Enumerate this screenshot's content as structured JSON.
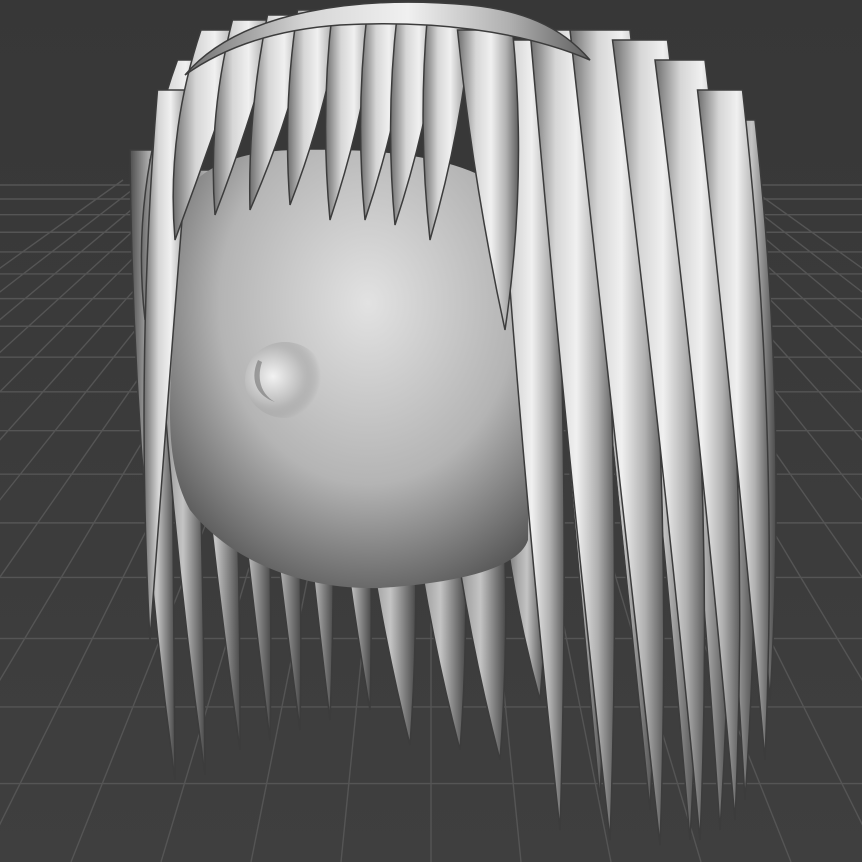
{
  "viewport": {
    "background_color": "#3a3a3a",
    "grid_line_color": "#555555",
    "model_base_color": "#c9c9c9",
    "model_shadow_color": "#2a2a2a"
  },
  "model": {
    "subject": "sculpted-hair-and-head-mesh",
    "material": "matcap-clay"
  }
}
